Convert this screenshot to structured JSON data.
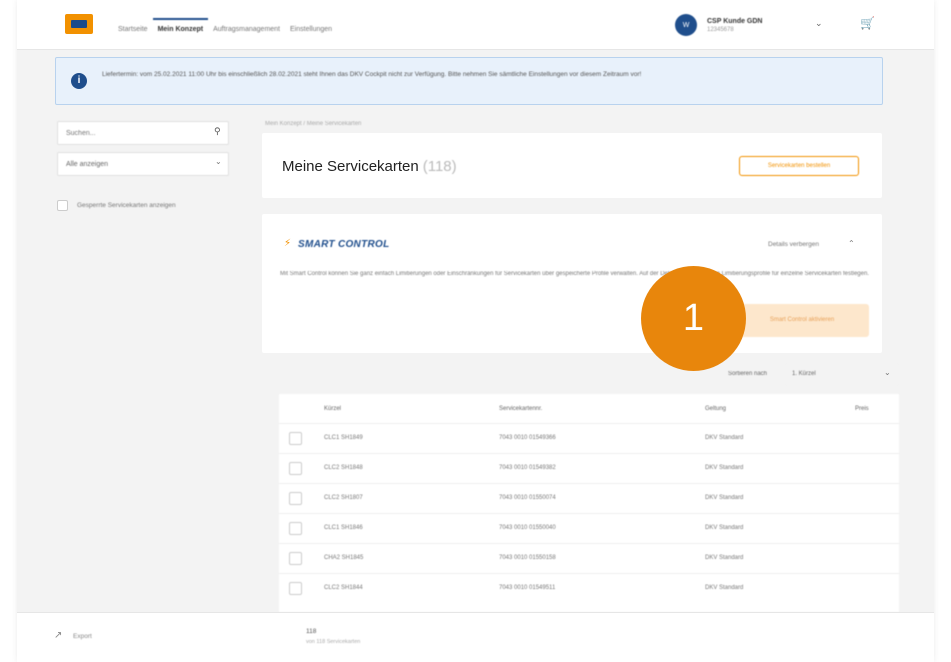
{
  "nav": {
    "tabs": [
      {
        "label": "Startseite"
      },
      {
        "label": "Mein Konzept"
      },
      {
        "label": "Auftragsmanagement"
      },
      {
        "label": "Einstellungen"
      }
    ]
  },
  "account": {
    "initials": "W",
    "name": "CSP Kunde GDN",
    "sub": "12345678"
  },
  "banner": {
    "text": "Liefertermin: vom 25.02.2021 11:00 Uhr bis einschließlich 28.02.2021 steht Ihnen das DKV Cockpit nicht zur Verfügung. Bitte nehmen Sie sämtliche Einstellungen vor diesem Zeitraum vor!"
  },
  "sidebar": {
    "search_placeholder": "Suchen...",
    "select_value": "Alle anzeigen",
    "checkbox_label": "Gesperrte Servicekarten anzeigen"
  },
  "breadcrumb": "Mein Konzept / Meine Servicekarten",
  "header": {
    "title": "Meine Servicekarten",
    "count": "(118)",
    "action_label": "Servicekarten bestellen"
  },
  "smart": {
    "title": "SMART CONTROL",
    "details_label": "Details verbergen",
    "description": "Mit Smart Control können Sie ganz einfach Limitierungen oder Einschränkungen für Servicekarten über gespeicherte Profile verwalten. Auf der Detailseite können Sie Limitierungsprofile für einzelne Servicekarten festlegen.",
    "button_label": "Smart Control aktivieren"
  },
  "step_marker": "1",
  "sort": {
    "label": "Sortieren nach",
    "value": "1. Kürzel"
  },
  "table": {
    "columns": [
      "Kürzel",
      "Servicekartennr.",
      "Geltung",
      "Preis"
    ],
    "rows": [
      {
        "code": "CLC1 SH1849",
        "number": "7043 0010 01549366",
        "validity": "DKV Standard"
      },
      {
        "code": "CLC2 SH1848",
        "number": "7043 0010 01549382",
        "validity": "DKV Standard"
      },
      {
        "code": "CLC2 SH1807",
        "number": "7043 0010 01550074",
        "validity": "DKV Standard"
      },
      {
        "code": "CLC1 SH1846",
        "number": "7043 0010 01550040",
        "validity": "DKV Standard"
      },
      {
        "code": "CHA2 SH1845",
        "number": "7043 0010 01550158",
        "validity": "DKV Standard"
      },
      {
        "code": "CLC2 SH1844",
        "number": "7043 0010 01549511",
        "validity": "DKV Standard"
      }
    ]
  },
  "footer": {
    "export_label": "Export",
    "count": "118",
    "sub": "von 118 Servicekarten"
  },
  "colors": {
    "brand_orange": "#f29100",
    "brand_blue": "#1f4e8c",
    "step_orange": "#e8860c"
  }
}
